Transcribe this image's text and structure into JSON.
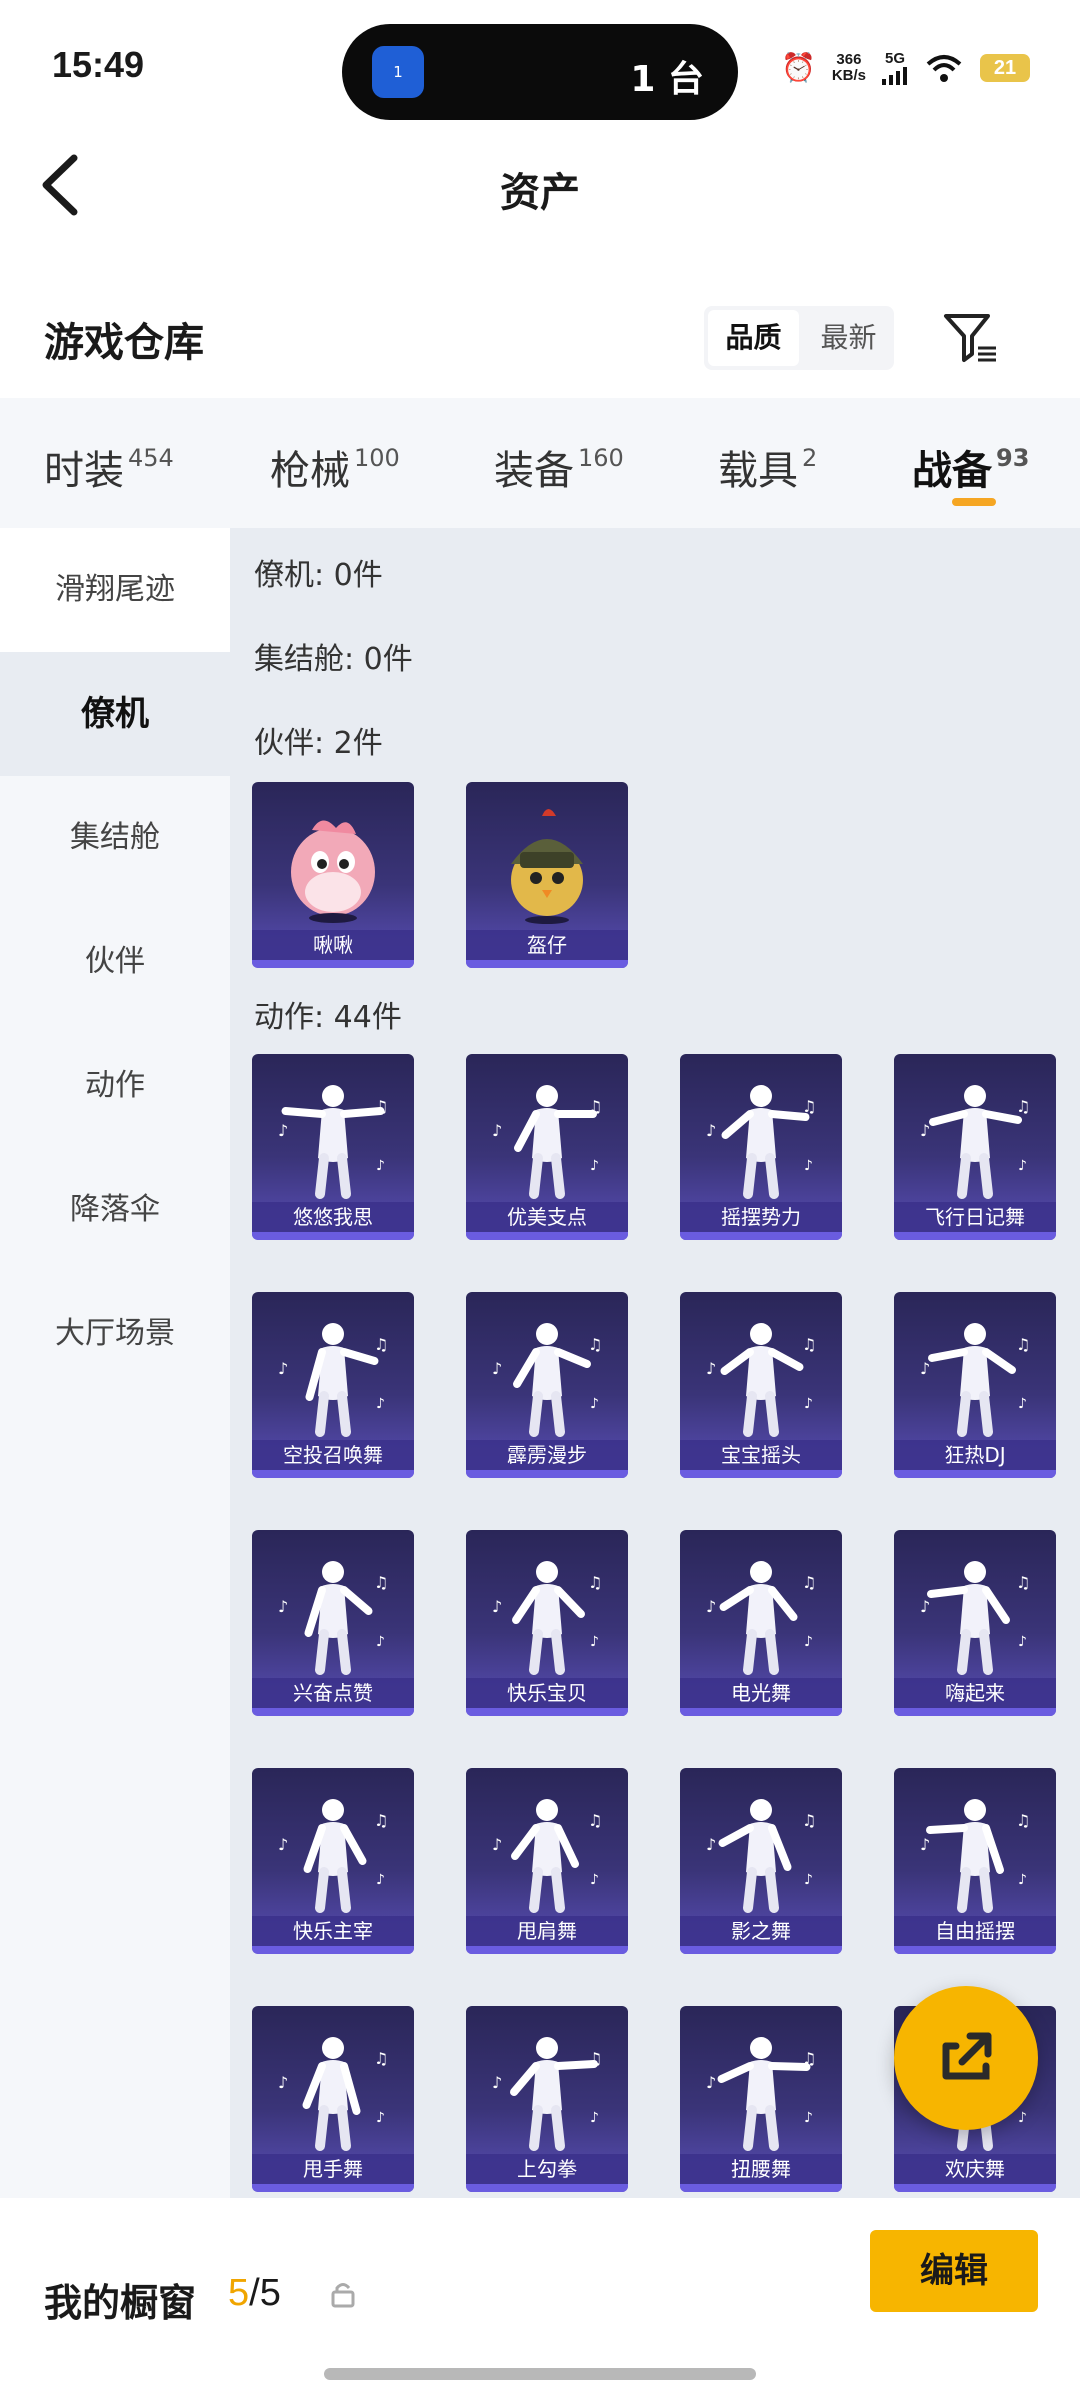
{
  "status_bar": {
    "time": "15:49",
    "island_app": "1",
    "island_count": "1 台",
    "net_speed_value": "366",
    "net_speed_unit": "KB/s",
    "network": "5G",
    "battery": "21"
  },
  "nav": {
    "title": "资产"
  },
  "warehouse": {
    "title": "游戏仓库",
    "sort_options": [
      "品质",
      "最新"
    ],
    "active_sort": "品质"
  },
  "tabs": [
    {
      "label": "时装",
      "count": "454"
    },
    {
      "label": "枪械",
      "count": "100"
    },
    {
      "label": "装备",
      "count": "160"
    },
    {
      "label": "载具",
      "count": "2"
    },
    {
      "label": "战备",
      "count": "93"
    }
  ],
  "active_tab": "战备",
  "sidebar": {
    "items": [
      "滑翔尾迹",
      "僚机",
      "集结舱",
      "伙伴",
      "动作",
      "降落伞",
      "大厅场景"
    ],
    "active": "僚机"
  },
  "sections": {
    "wingman": "僚机: 0件",
    "rally_pod": "集结舱: 0件",
    "partner": "伙伴: 2件",
    "emote": "动作: 44件"
  },
  "partners": [
    {
      "name": "啾啾"
    },
    {
      "name": "盔仔"
    }
  ],
  "emotes": [
    "悠悠我思",
    "优美支点",
    "摇摆势力",
    "飞行日记舞",
    "空投召唤舞",
    "霹雳漫步",
    "宝宝摇头",
    "狂热DJ",
    "兴奋点赞",
    "快乐宝贝",
    "电光舞",
    "嗨起来",
    "快乐主宰",
    "甩肩舞",
    "影之舞",
    "自由摇摆",
    "甩手舞",
    "上勾拳",
    "扭腰舞",
    "欢庆舞"
  ],
  "showcase": {
    "title": "我的橱窗",
    "current": "5",
    "total": "/5",
    "edit_label": "编辑"
  },
  "colors": {
    "accent": "#f7b500",
    "card_top": "#2a2658",
    "card_bottom": "#5a4fb8"
  },
  "icons": [
    "back-icon",
    "filter-icon",
    "lock-icon",
    "share-icon",
    "alarm-icon",
    "wifi-icon",
    "signal-icon"
  ]
}
